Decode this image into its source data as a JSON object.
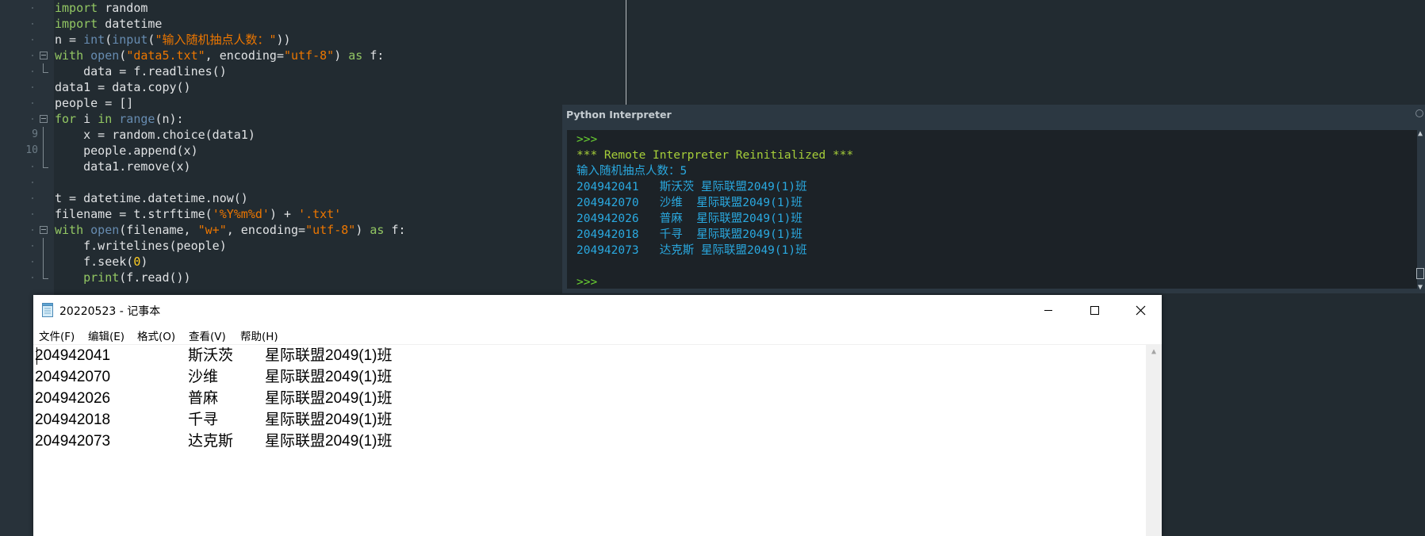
{
  "editor": {
    "line_numbers": [
      "9",
      "10"
    ],
    "lines": [
      [
        {
          "t": "import",
          "c": "kw"
        },
        {
          "t": " random",
          "c": "default"
        }
      ],
      [
        {
          "t": "import",
          "c": "kw"
        },
        {
          "t": " datetime",
          "c": "default"
        }
      ],
      [
        {
          "t": "n = ",
          "c": "default"
        },
        {
          "t": "int",
          "c": "fn"
        },
        {
          "t": "(",
          "c": "default"
        },
        {
          "t": "input",
          "c": "fn"
        },
        {
          "t": "(",
          "c": "default"
        },
        {
          "t": "\"输入随机抽点人数：\"",
          "c": "str"
        },
        {
          "t": "))",
          "c": "default"
        }
      ],
      [
        {
          "t": "with",
          "c": "kw"
        },
        {
          "t": " ",
          "c": "default"
        },
        {
          "t": "open",
          "c": "fn"
        },
        {
          "t": "(",
          "c": "default"
        },
        {
          "t": "\"data5.txt\"",
          "c": "str"
        },
        {
          "t": ", encoding=",
          "c": "default"
        },
        {
          "t": "\"utf-8\"",
          "c": "str"
        },
        {
          "t": ") ",
          "c": "default"
        },
        {
          "t": "as",
          "c": "kw"
        },
        {
          "t": " f:",
          "c": "default"
        }
      ],
      [
        {
          "t": "    data = f.readlines()",
          "c": "default"
        }
      ],
      [
        {
          "t": "data1 = data.copy()",
          "c": "default"
        }
      ],
      [
        {
          "t": "people = []",
          "c": "default"
        }
      ],
      [
        {
          "t": "for",
          "c": "kw"
        },
        {
          "t": " i ",
          "c": "default"
        },
        {
          "t": "in",
          "c": "kw"
        },
        {
          "t": " ",
          "c": "default"
        },
        {
          "t": "range",
          "c": "fn"
        },
        {
          "t": "(n):",
          "c": "default"
        }
      ],
      [
        {
          "t": "    x = random.choice(data1)",
          "c": "default"
        }
      ],
      [
        {
          "t": "    people.append(x)",
          "c": "default"
        }
      ],
      [
        {
          "t": "    data1.remove(x)",
          "c": "default"
        }
      ],
      [],
      [
        {
          "t": "t = datetime.datetime.now()",
          "c": "default"
        }
      ],
      [
        {
          "t": "filename = t.strftime(",
          "c": "default"
        },
        {
          "t": "'%Y%m%d'",
          "c": "str"
        },
        {
          "t": ") + ",
          "c": "default"
        },
        {
          "t": "'.txt'",
          "c": "str"
        }
      ],
      [
        {
          "t": "with",
          "c": "kw"
        },
        {
          "t": " ",
          "c": "default"
        },
        {
          "t": "open",
          "c": "fn"
        },
        {
          "t": "(filename, ",
          "c": "default"
        },
        {
          "t": "\"w+\"",
          "c": "str"
        },
        {
          "t": ", encoding=",
          "c": "default"
        },
        {
          "t": "\"utf-8\"",
          "c": "str"
        },
        {
          "t": ") ",
          "c": "default"
        },
        {
          "t": "as",
          "c": "kw"
        },
        {
          "t": " f:",
          "c": "default"
        }
      ],
      [
        {
          "t": "    f.writelines(people)",
          "c": "default"
        }
      ],
      [
        {
          "t": "    f.seek(",
          "c": "default"
        },
        {
          "t": "0",
          "c": "num"
        },
        {
          "t": ")",
          "c": "default"
        }
      ],
      [
        {
          "t": "    ",
          "c": "default"
        },
        {
          "t": "print",
          "c": "kw"
        },
        {
          "t": "(f.read())",
          "c": "default"
        }
      ]
    ]
  },
  "interpreter": {
    "title": "Python Interpreter",
    "lines": [
      {
        "text": ">>>",
        "kind": "prompt"
      },
      {
        "text": "*** Remote Interpreter Reinitialized ***",
        "kind": "info"
      },
      {
        "text": "输入随机抽点人数：5",
        "kind": "prompt-text"
      },
      {
        "text": "204942041   斯沃茨 星际联盟2049(1)班",
        "kind": "out"
      },
      {
        "text": "204942070   沙维  星际联盟2049(1)班",
        "kind": "out"
      },
      {
        "text": "204942026   普麻  星际联盟2049(1)班",
        "kind": "out"
      },
      {
        "text": "204942018   千寻  星际联盟2049(1)班",
        "kind": "out"
      },
      {
        "text": "204942073   达克斯 星际联盟2049(1)班",
        "kind": "out"
      },
      {
        "text": "",
        "kind": "out"
      },
      {
        "text": ">>>",
        "kind": "prompt"
      }
    ]
  },
  "notepad": {
    "title": "20220523 - 记事本",
    "menu": [
      "文件(F)",
      "编辑(E)",
      "格式(O)",
      "查看(V)",
      "帮助(H)"
    ],
    "rows": [
      {
        "id": "204942041",
        "name": "斯沃茨",
        "class": "星际联盟2049(1)班"
      },
      {
        "id": "204942070",
        "name": "沙维",
        "class": "星际联盟2049(1)班"
      },
      {
        "id": "204942026",
        "name": "普麻",
        "class": "星际联盟2049(1)班"
      },
      {
        "id": "204942018",
        "name": "千寻",
        "class": "星际联盟2049(1)班"
      },
      {
        "id": "204942073",
        "name": "达克斯",
        "class": "星际联盟2049(1)班"
      }
    ]
  },
  "colors": {
    "keyword": "#93c763",
    "builtin": "#678cb1",
    "string": "#ec7600",
    "number": "#ffcd22",
    "console_output": "#2aa9e0"
  }
}
